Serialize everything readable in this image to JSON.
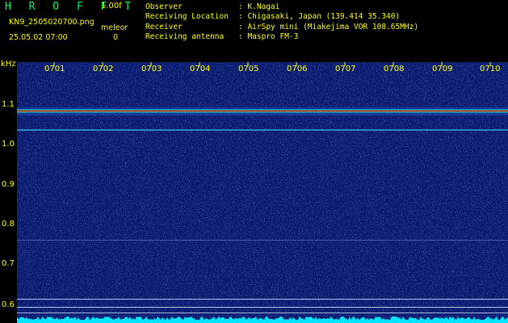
{
  "header": {
    "brand": "H R O F F T",
    "version": "1.00f",
    "filename": "KN9_2505020700.png",
    "mode": "meleor",
    "timestamp": "25.05.02 07:00",
    "count": "0"
  },
  "info": {
    "observer_label": "Observer",
    "observer_value": "K.Nagai",
    "location_label": "Receiving Location",
    "location_value": "Chigasaki, Japan (139.414 35.340)",
    "receiver_label": "Receiver",
    "receiver_value": "AirSpy mini (Miakejima VOR 108.65MHz)",
    "antenna_label": "Receiving antenna",
    "antenna_value": "Maspro FM-3"
  },
  "axis": {
    "y_unit": "kHz",
    "y_ticks": [
      "1.1",
      "1.0",
      "0.9",
      "0.8",
      "0.7",
      "0.6"
    ],
    "x_ticks": [
      "0701",
      "0702",
      "0703",
      "0704",
      "0705",
      "0706",
      "0707",
      "0708",
      "0709",
      "0710"
    ]
  },
  "colors": {
    "background": "#000000",
    "waterfall_bg": "#0a1a6e",
    "text": "#ffff00",
    "brand": "#00ff66",
    "carrier": "#ff3b00",
    "noise_floor": "#00e5ff"
  }
}
